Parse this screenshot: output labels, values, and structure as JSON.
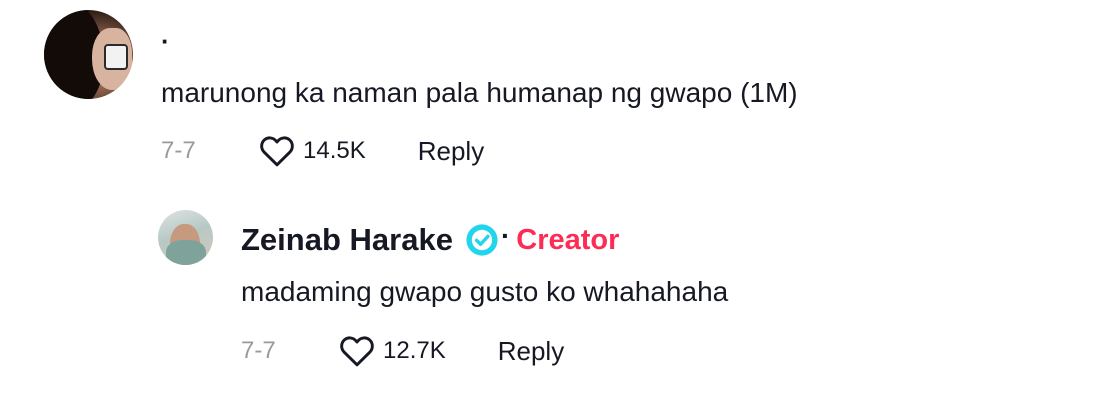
{
  "comment": {
    "username": "·",
    "text": "marunong ka naman pala humanap ng gwapo (1M)",
    "date": "7-7",
    "likes": "14.5K",
    "reply_label": "Reply"
  },
  "reply": {
    "username": "Zeinab Harake",
    "separator": "·",
    "badge": "Creator",
    "text": "madaming gwapo gusto ko whahahaha",
    "date": "7-7",
    "likes": "12.7K",
    "reply_label": "Reply"
  },
  "colors": {
    "creator_badge": "#fe2c55",
    "verified": "#20d5ec",
    "meta_gray": "#9a9a9e",
    "text": "#161823"
  },
  "icons": {
    "like": "heart-outline-icon",
    "verified": "verified-check-icon"
  }
}
